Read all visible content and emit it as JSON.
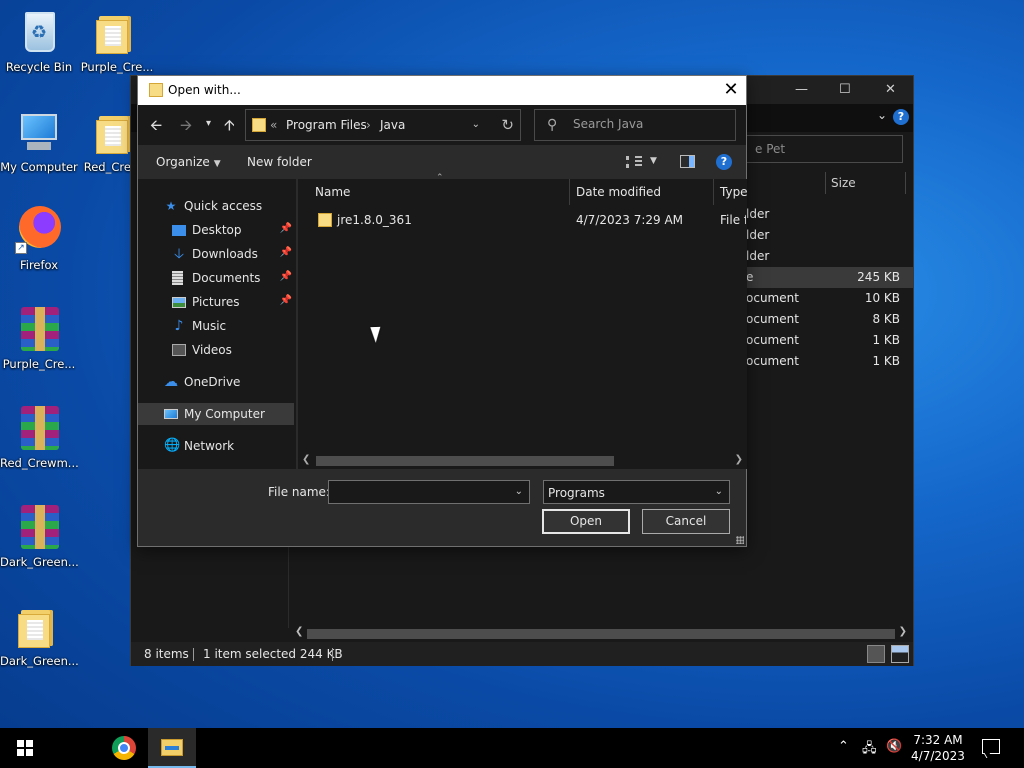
{
  "desktop": {
    "icons": [
      {
        "label": "Recycle Bin",
        "icon": "recycle-bin-icon"
      },
      {
        "label": "Purple_Cre...",
        "icon": "folder-icon"
      },
      {
        "label": "My Computer",
        "icon": "computer-icon"
      },
      {
        "label": "Red_Crew...",
        "icon": "folder-icon"
      },
      {
        "label": "Firefox",
        "icon": "firefox-icon"
      },
      {
        "label": "Purple_Cre...",
        "icon": "winrar-icon"
      },
      {
        "label": "Red_Crewm...",
        "icon": "winrar-icon"
      },
      {
        "label": "Dark_Green...",
        "icon": "winrar-icon"
      },
      {
        "label": "Dark_Green...",
        "icon": "folder-icon"
      }
    ]
  },
  "background_window": {
    "search_placeholder": "e Pet",
    "column_size": "Size",
    "rows": [
      {
        "type": "lder",
        "size": ""
      },
      {
        "type": "lder",
        "size": ""
      },
      {
        "type": "lder",
        "size": ""
      },
      {
        "type": "e",
        "size": "245 KB"
      },
      {
        "type": "ocument",
        "size": "10 KB"
      },
      {
        "type": "ocument",
        "size": "8 KB"
      },
      {
        "type": "ocument",
        "size": "1 KB"
      },
      {
        "type": "ocument",
        "size": "1 KB"
      }
    ],
    "status": {
      "items": "8 items",
      "selected": "1 item selected  244 KB"
    }
  },
  "dialog": {
    "title": "Open with...",
    "address": {
      "overflow": "«",
      "crumbs": [
        "Program Files",
        "Java"
      ],
      "separator": "›"
    },
    "search_placeholder": "Search Java",
    "toolbar": {
      "organize": "Organize",
      "new_folder": "New folder"
    },
    "nav": [
      {
        "label": "Quick access",
        "icon": "star-icon"
      },
      {
        "label": "Desktop",
        "icon": "desktop-icon",
        "pinned": true
      },
      {
        "label": "Downloads",
        "icon": "download-icon",
        "pinned": true
      },
      {
        "label": "Documents",
        "icon": "documents-icon",
        "pinned": true
      },
      {
        "label": "Pictures",
        "icon": "pictures-icon",
        "pinned": true
      },
      {
        "label": "Music",
        "icon": "music-icon"
      },
      {
        "label": "Videos",
        "icon": "videos-icon"
      },
      {
        "label": "OneDrive",
        "icon": "cloud-icon"
      },
      {
        "label": "My Computer",
        "icon": "computer-icon",
        "selected": true
      },
      {
        "label": "Network",
        "icon": "network-icon"
      }
    ],
    "columns": {
      "name": "Name",
      "date": "Date modified",
      "type": "Type"
    },
    "files": [
      {
        "name": "jre1.8.0_361",
        "date": "4/7/2023 7:29 AM",
        "type": "File fo"
      }
    ],
    "file_name_label": "File name:",
    "file_name_value": "",
    "file_type": "Programs",
    "open_label": "Open",
    "cancel_label": "Cancel"
  },
  "taskbar": {
    "time": "7:32 AM",
    "date": "4/7/2023"
  },
  "colors": {
    "accent": "#1f6fd1",
    "dark_bg": "#191919",
    "panel_bg": "#2b2b2b",
    "folder": "#f8dc85"
  }
}
